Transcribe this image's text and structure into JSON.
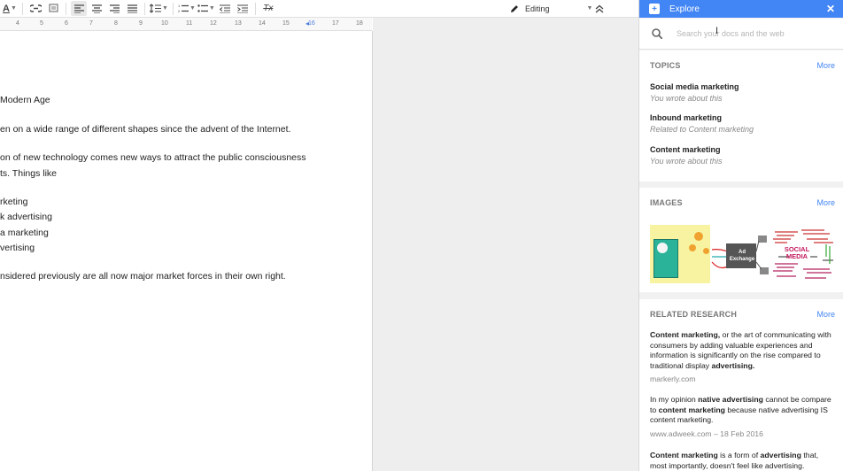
{
  "toolbar": {
    "items": [
      "text-color",
      "link",
      "comment",
      "align-left",
      "align-center",
      "align-right",
      "justify",
      "line-spacing",
      "numbered-list",
      "bulleted-list",
      "decrease-indent",
      "increase-indent",
      "clear-formatting"
    ],
    "font_color_glyph": "A",
    "clear_glyph": "Tx",
    "mode_label": "Editing"
  },
  "ruler": {
    "numbers": [
      "4",
      "5",
      "6",
      "7",
      "8",
      "9",
      "10",
      "11",
      "12",
      "13",
      "14",
      "15",
      "16",
      "17",
      "18"
    ]
  },
  "document": {
    "lines": [
      "Modern Age",
      "en on a wide range of different shapes since the advent of the Internet.",
      "on of new technology comes new ways to attract the public consciousness",
      "ts. Things like",
      "rketing",
      "k advertising",
      "a marketing",
      "vertising",
      "nsidered previously are all now major market forces in their own right."
    ]
  },
  "explore": {
    "title": "Explore",
    "search_placeholder": "Search your docs and the web",
    "topics": {
      "title": "TOPICS",
      "more": "More",
      "items": [
        {
          "name": "Social media marketing",
          "sub": "You wrote about this"
        },
        {
          "name": "Inbound marketing",
          "sub": "Related to Content marketing"
        },
        {
          "name": "Content marketing",
          "sub": "You wrote about this"
        }
      ]
    },
    "images": {
      "title": "IMAGES",
      "more": "More",
      "ad_exchange_label": "Ad Exchange",
      "wordcloud_label": "SOCIAL MEDIA"
    },
    "research": {
      "title": "RELATED RESEARCH",
      "more": "More",
      "items": [
        {
          "pre": "",
          "b1": "Content marketing,",
          "mid": " or the art of communicating with consumers by adding valuable experiences and information is significantly on the rise compared to traditional display ",
          "b2": "advertising.",
          "post": "",
          "source": "markerly.com"
        },
        {
          "pre": "In my opinion ",
          "b1": "native advertising",
          "mid": " cannot be compare to ",
          "b2": "content marketing",
          "post": " because native advertising IS content marketing.",
          "source": "www.adweek.com – 18 Feb 2016"
        },
        {
          "pre": "",
          "b1": "Content marketing",
          "mid": " is a form of ",
          "b2": "advertising",
          "post": " that, most importantly, doesn't feel like advertising.",
          "source": ""
        }
      ]
    }
  },
  "colors": {
    "accent": "#4285f4",
    "panel_bg": "#f1f1f1"
  }
}
